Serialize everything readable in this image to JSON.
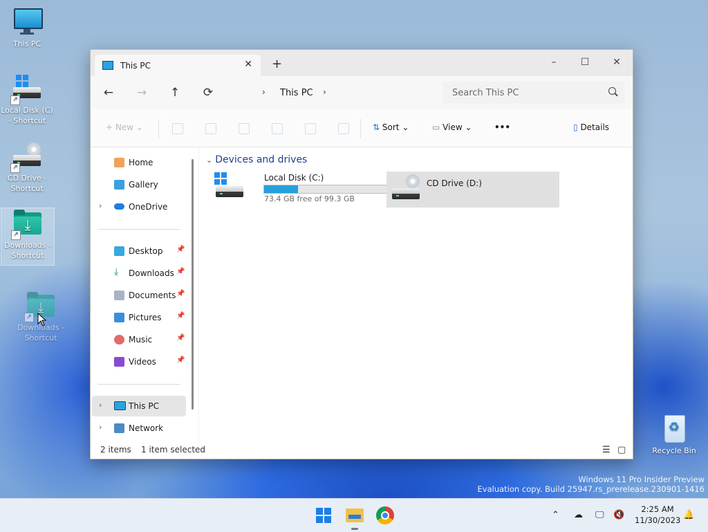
{
  "desktop": {
    "icons": [
      {
        "label": "This PC",
        "icon": "monitor-icon"
      },
      {
        "label": "Local Disk (C) - Shortcut",
        "icon": "local-disk-icon"
      },
      {
        "label": "CD Drive - Shortcut",
        "icon": "cd-drive-icon"
      },
      {
        "label": "Downloads - Shortcut",
        "icon": "downloads-folder-icon"
      },
      {
        "label": "Downloads - Shortcut",
        "icon": "downloads-folder-icon"
      },
      {
        "label": "Recycle Bin",
        "icon": "recycle-bin-icon"
      }
    ]
  },
  "window": {
    "tab_title": "This PC",
    "new_tab": "+",
    "controls": {
      "minimize": "–",
      "maximize": "☐",
      "close": "✕"
    },
    "nav": {
      "back": "←",
      "forward": "→",
      "up": "↑",
      "refresh": "⟳"
    },
    "breadcrumb": "This PC",
    "search_placeholder": "Search This PC",
    "command_bar": {
      "new_label": "New",
      "sort_label": "Sort",
      "view_label": "View",
      "more_label": "•••",
      "details_label": "Details"
    },
    "nav_pane": {
      "top": [
        "Home",
        "Gallery",
        "OneDrive"
      ],
      "pinned": [
        "Desktop",
        "Downloads",
        "Documents",
        "Pictures",
        "Music",
        "Videos"
      ],
      "bottom": [
        "This PC",
        "Network"
      ]
    },
    "content": {
      "group_title": "Devices and drives",
      "drives": [
        {
          "name": "Local Disk (C:)",
          "free": "73.4 GB free of 99.3 GB",
          "used_fraction": 0.26
        },
        {
          "name": "CD Drive (D:)",
          "free": ""
        }
      ]
    },
    "status": {
      "items": "2 items",
      "selected": "1 item selected"
    }
  },
  "watermark": {
    "line1": "Windows 11 Pro Insider Preview",
    "line2": "Evaluation copy. Build 25947.rs_prerelease.230901-1416"
  },
  "taskbar": {
    "apps": [
      "start-icon",
      "file-explorer-icon",
      "chrome-icon"
    ],
    "tray": {
      "chevron": "⌃"
    },
    "clock": {
      "time": "2:25 AM",
      "date": "11/30/2023"
    }
  }
}
